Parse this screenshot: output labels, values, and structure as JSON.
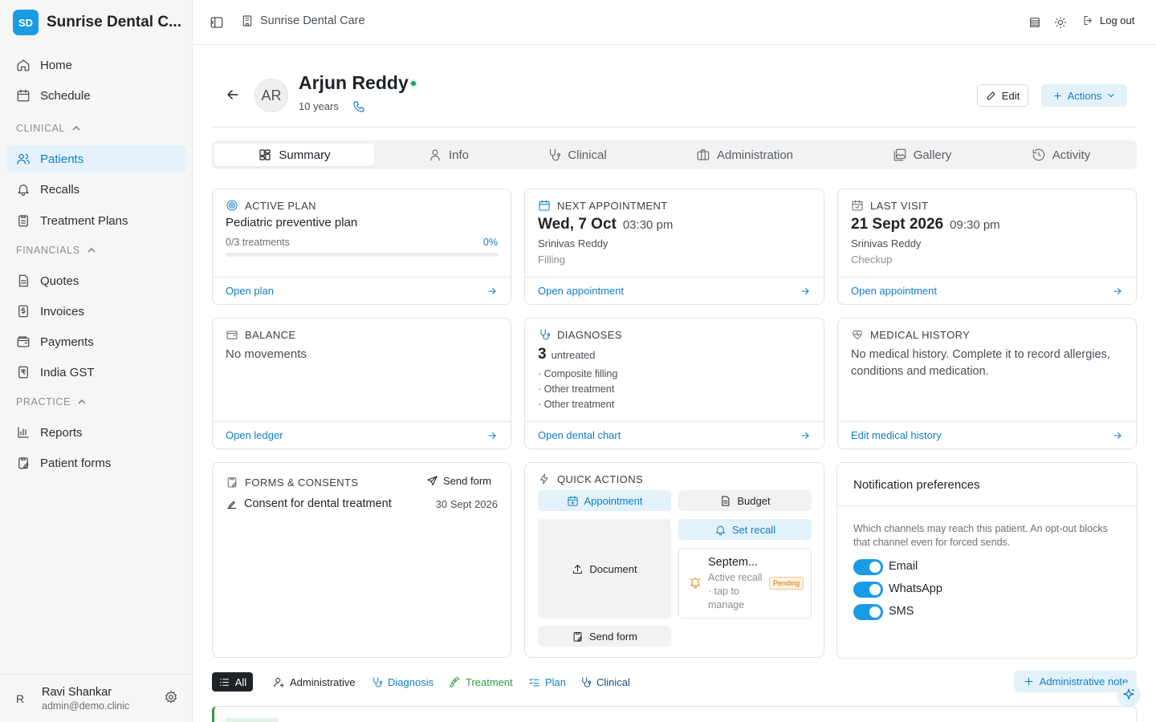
{
  "brand": {
    "initials": "SD",
    "name": "Sunrise Dental C..."
  },
  "sidebar": {
    "home": "Home",
    "schedule": "Schedule",
    "clinical_section": "CLINICAL",
    "patients": "Patients",
    "recalls": "Recalls",
    "treatment_plans": "Treatment Plans",
    "financials_section": "FINANCIALS",
    "quotes": "Quotes",
    "invoices": "Invoices",
    "payments": "Payments",
    "india_gst": "India GST",
    "practice_section": "PRACTICE",
    "reports": "Reports",
    "patient_forms": "Patient forms"
  },
  "user": {
    "initial": "R",
    "name": "Ravi Shankar",
    "email": "admin@demo.clinic"
  },
  "topbar": {
    "clinic": "Sunrise Dental Care",
    "logout": "Log out"
  },
  "patient": {
    "initials": "AR",
    "name": "Arjun Reddy",
    "age": "10 years",
    "status_color": "#1aa35f"
  },
  "header_actions": {
    "edit": "Edit",
    "actions": "Actions"
  },
  "tabs": [
    "Summary",
    "Info",
    "Clinical",
    "Administration",
    "Gallery",
    "Activity"
  ],
  "active_plan": {
    "title": "ACTIVE PLAN",
    "name": "Pediatric preventive plan",
    "treatments": "0/3 treatments",
    "percent": "0%",
    "progress": 0,
    "link": "Open plan"
  },
  "next_appointment": {
    "title": "NEXT APPOINTMENT",
    "date": "Wed, 7 Oct",
    "time": "03:30 pm",
    "doctor": "Srinivas Reddy",
    "type": "Filling",
    "link": "Open appointment"
  },
  "last_visit": {
    "title": "LAST VISIT",
    "date": "21 Sept 2026",
    "time": "09:30 pm",
    "doctor": "Srinivas Reddy",
    "type": "Checkup",
    "link": "Open appointment"
  },
  "balance": {
    "title": "BALANCE",
    "text": "No movements",
    "link": "Open ledger"
  },
  "diagnoses": {
    "title": "DIAGNOSES",
    "count": "3",
    "count_label": "untreated",
    "items": [
      "· Composite filling",
      "· Other treatment",
      "· Other treatment"
    ],
    "link": "Open dental chart"
  },
  "medical_history": {
    "title": "MEDICAL HISTORY",
    "text": "No medical history. Complete it to record allergies, conditions and medication.",
    "link": "Edit medical history"
  },
  "forms": {
    "title": "FORMS & CONSENTS",
    "send": "Send form",
    "item": "Consent for dental treatment",
    "date": "30 Sept 2026"
  },
  "quick_actions": {
    "title": "QUICK ACTIONS",
    "appointment": "Appointment",
    "budget": "Budget",
    "set_recall": "Set recall",
    "document": "Document",
    "recall_title": "Septem...",
    "recall_desc": "Active recall · tap to manage",
    "recall_badge": "Pending",
    "send_form": "Send form"
  },
  "notifications": {
    "title": "Notification preferences",
    "desc": "Which channels may reach this patient. An opt-out blocks that channel even for forced sends.",
    "channels": [
      "Email",
      "WhatsApp",
      "SMS"
    ]
  },
  "timeline": {
    "all": "All",
    "administrative": "Administrative",
    "diagnosis": "Diagnosis",
    "treatment": "Treatment",
    "plan": "Plan",
    "clinical": "Clinical",
    "add_note": "Administrative note"
  },
  "colors": {
    "accent": "#117fc4",
    "accent_bg": "#e3f1fb",
    "treatment": "#2e9a45",
    "pending": "#e08a16"
  }
}
